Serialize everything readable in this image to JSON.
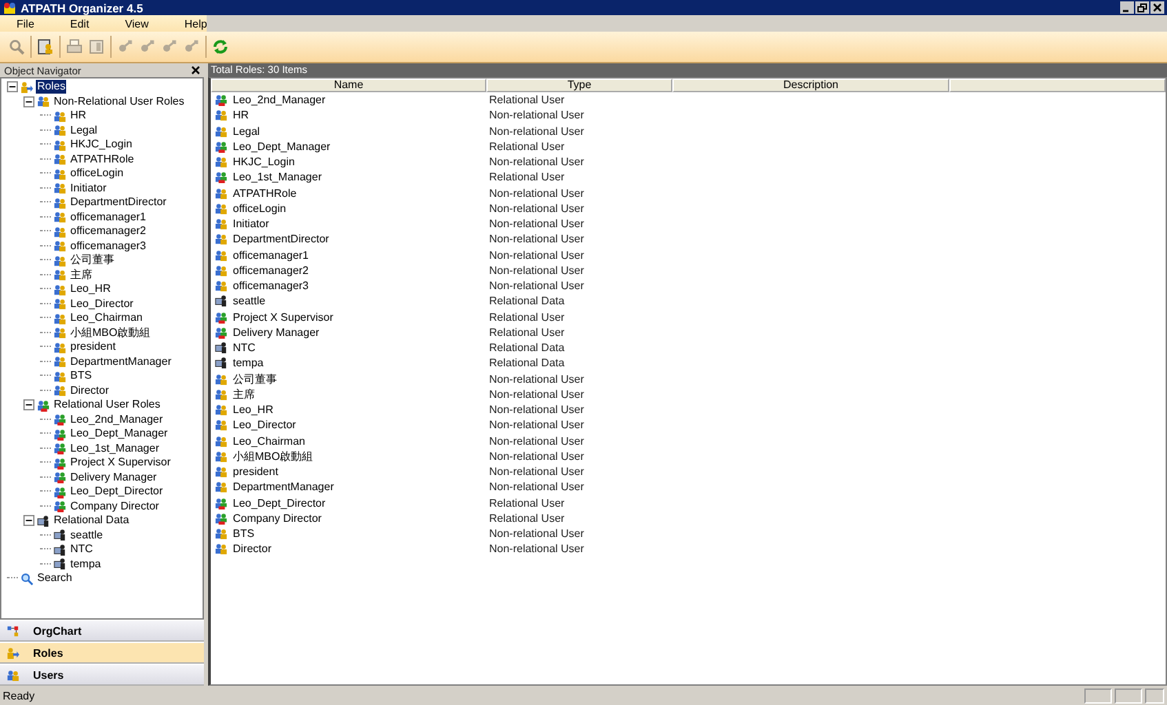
{
  "window": {
    "title": "ATPATH Organizer 4.5"
  },
  "menu": [
    "File",
    "Edit",
    "View",
    "Help"
  ],
  "toolbar": [
    {
      "kind": "search",
      "disabled": true
    },
    {
      "kind": "clipboard",
      "disabled": false
    },
    {
      "kind": "print",
      "disabled": true
    },
    {
      "kind": "preview",
      "disabled": true
    },
    {
      "kind": "arrow",
      "disabled": true
    },
    {
      "kind": "arrow",
      "disabled": true
    },
    {
      "kind": "arrow",
      "disabled": true
    },
    {
      "kind": "arrow",
      "disabled": true
    },
    {
      "kind": "refresh",
      "disabled": false
    }
  ],
  "navigator": {
    "title": "Object Navigator",
    "tree": [
      {
        "label": "Roles",
        "kind": "roles",
        "selected": true,
        "expanded": true,
        "children": [
          {
            "label": "Non-Relational User Roles",
            "kind": "nonrel",
            "selected": false,
            "expanded": true,
            "children": [
              {
                "label": "HR",
                "kind": "nonrel",
                "selected": false
              },
              {
                "label": "Legal",
                "kind": "nonrel",
                "selected": false
              },
              {
                "label": "HKJC_Login",
                "kind": "nonrel",
                "selected": false
              },
              {
                "label": "ATPATHRole",
                "kind": "nonrel",
                "selected": false
              },
              {
                "label": "officeLogin",
                "kind": "nonrel",
                "selected": false
              },
              {
                "label": "Initiator",
                "kind": "nonrel",
                "selected": false
              },
              {
                "label": "DepartmentDirector",
                "kind": "nonrel",
                "selected": false
              },
              {
                "label": "officemanager1",
                "kind": "nonrel",
                "selected": false
              },
              {
                "label": "officemanager2",
                "kind": "nonrel",
                "selected": false
              },
              {
                "label": "officemanager3",
                "kind": "nonrel",
                "selected": false
              },
              {
                "label": "公司董事",
                "kind": "nonrel",
                "selected": false
              },
              {
                "label": "主席",
                "kind": "nonrel",
                "selected": false
              },
              {
                "label": "Leo_HR",
                "kind": "nonrel",
                "selected": false
              },
              {
                "label": "Leo_Director",
                "kind": "nonrel",
                "selected": false
              },
              {
                "label": "Leo_Chairman",
                "kind": "nonrel",
                "selected": false
              },
              {
                "label": "小組MBO啟動組",
                "kind": "nonrel",
                "selected": false
              },
              {
                "label": "president",
                "kind": "nonrel",
                "selected": false
              },
              {
                "label": "DepartmentManager",
                "kind": "nonrel",
                "selected": false
              },
              {
                "label": "BTS",
                "kind": "nonrel",
                "selected": false
              },
              {
                "label": "Director",
                "kind": "nonrel",
                "selected": false
              }
            ]
          },
          {
            "label": "Relational User Roles",
            "kind": "rel",
            "selected": false,
            "expanded": true,
            "children": [
              {
                "label": "Leo_2nd_Manager",
                "kind": "rel",
                "selected": false
              },
              {
                "label": "Leo_Dept_Manager",
                "kind": "rel",
                "selected": false
              },
              {
                "label": "Leo_1st_Manager",
                "kind": "rel",
                "selected": false
              },
              {
                "label": "Project X Supervisor",
                "kind": "rel",
                "selected": false
              },
              {
                "label": "Delivery Manager",
                "kind": "rel",
                "selected": false
              },
              {
                "label": "Leo_Dept_Director",
                "kind": "rel",
                "selected": false
              },
              {
                "label": "Company Director",
                "kind": "rel",
                "selected": false
              }
            ]
          },
          {
            "label": "Relational Data",
            "kind": "data",
            "selected": false,
            "expanded": true,
            "children": [
              {
                "label": "seattle",
                "kind": "data",
                "selected": false
              },
              {
                "label": "NTC",
                "kind": "data",
                "selected": false
              },
              {
                "label": "tempa",
                "kind": "data",
                "selected": false
              }
            ]
          }
        ]
      },
      {
        "label": "Search",
        "kind": "search",
        "selected": false
      }
    ]
  },
  "nav_buttons": [
    {
      "label": "OrgChart",
      "kind": "orgchart",
      "selected": false
    },
    {
      "label": "Roles",
      "kind": "roles",
      "selected": true
    },
    {
      "label": "Users",
      "kind": "users",
      "selected": false
    }
  ],
  "table": {
    "caption": "Total Roles: 30 Items",
    "columns": [
      "Name",
      "Type",
      "Description"
    ],
    "rows": [
      {
        "name": "Leo_2nd_Manager",
        "type": "Relational User",
        "kind": "rel"
      },
      {
        "name": "HR",
        "type": "Non-relational User",
        "kind": "nonrel"
      },
      {
        "name": "Legal",
        "type": "Non-relational User",
        "kind": "nonrel"
      },
      {
        "name": "Leo_Dept_Manager",
        "type": "Relational User",
        "kind": "rel"
      },
      {
        "name": "HKJC_Login",
        "type": "Non-relational User",
        "kind": "nonrel"
      },
      {
        "name": "Leo_1st_Manager",
        "type": "Relational User",
        "kind": "rel"
      },
      {
        "name": "ATPATHRole",
        "type": "Non-relational User",
        "kind": "nonrel"
      },
      {
        "name": "officeLogin",
        "type": "Non-relational User",
        "kind": "nonrel"
      },
      {
        "name": "Initiator",
        "type": "Non-relational User",
        "kind": "nonrel"
      },
      {
        "name": "DepartmentDirector",
        "type": "Non-relational User",
        "kind": "nonrel"
      },
      {
        "name": "officemanager1",
        "type": "Non-relational User",
        "kind": "nonrel"
      },
      {
        "name": "officemanager2",
        "type": "Non-relational User",
        "kind": "nonrel"
      },
      {
        "name": "officemanager3",
        "type": "Non-relational User",
        "kind": "nonrel"
      },
      {
        "name": "seattle",
        "type": "Relational Data",
        "kind": "data"
      },
      {
        "name": "Project X Supervisor",
        "type": "Relational User",
        "kind": "rel"
      },
      {
        "name": "Delivery Manager",
        "type": "Relational User",
        "kind": "rel"
      },
      {
        "name": "NTC",
        "type": "Relational Data",
        "kind": "data"
      },
      {
        "name": "tempa",
        "type": "Relational Data",
        "kind": "data"
      },
      {
        "name": "公司董事",
        "type": "Non-relational User",
        "kind": "nonrel"
      },
      {
        "name": "主席",
        "type": "Non-relational User",
        "kind": "nonrel"
      },
      {
        "name": "Leo_HR",
        "type": "Non-relational User",
        "kind": "nonrel"
      },
      {
        "name": "Leo_Director",
        "type": "Non-relational User",
        "kind": "nonrel"
      },
      {
        "name": "Leo_Chairman",
        "type": "Non-relational User",
        "kind": "nonrel"
      },
      {
        "name": "小組MBO啟動組",
        "type": "Non-relational User",
        "kind": "nonrel"
      },
      {
        "name": "president",
        "type": "Non-relational User",
        "kind": "nonrel"
      },
      {
        "name": "DepartmentManager",
        "type": "Non-relational User",
        "kind": "nonrel"
      },
      {
        "name": "Leo_Dept_Director",
        "type": "Relational User",
        "kind": "rel"
      },
      {
        "name": "Company Director",
        "type": "Relational User",
        "kind": "rel"
      },
      {
        "name": "BTS",
        "type": "Non-relational User",
        "kind": "nonrel"
      },
      {
        "name": "Director",
        "type": "Non-relational User",
        "kind": "nonrel"
      }
    ]
  },
  "status_bar": {
    "text": "Ready"
  }
}
